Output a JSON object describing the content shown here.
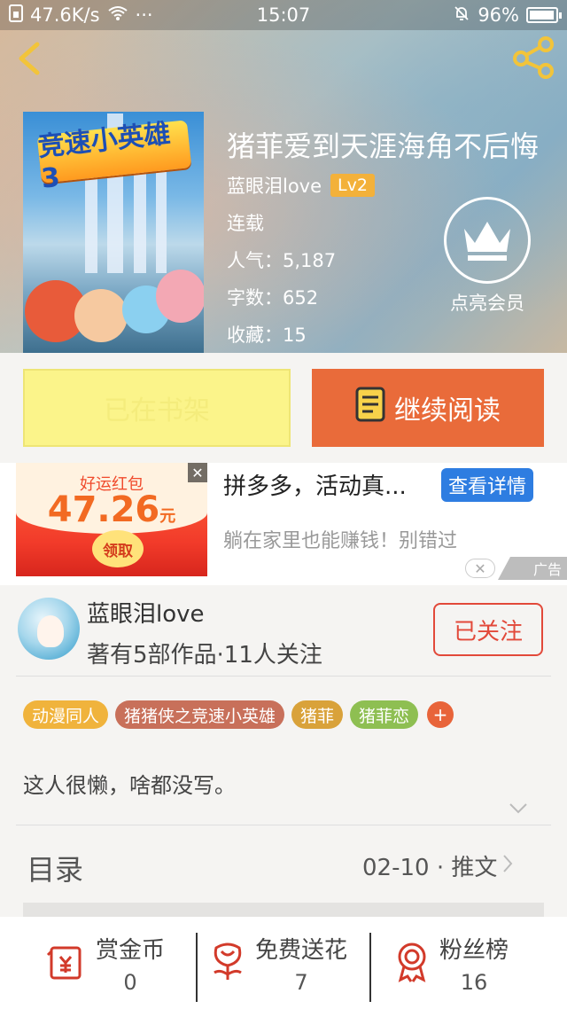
{
  "status_bar": {
    "network_speed": "47.6K/s",
    "dots": "···",
    "time": "15:07",
    "battery": "96%",
    "battery_level": 0.96
  },
  "book": {
    "title": "猪菲爱到天涯海角不后悔",
    "author": "蓝眼泪love",
    "level": "Lv2",
    "status": "连载",
    "popularity": "人气：5,187",
    "word_count": "字数：652",
    "favorites": "收藏：15",
    "cover_logo": "竞速小英雄3"
  },
  "vip": {
    "label": "点亮会员"
  },
  "actions": {
    "shelf_label": "已在书架",
    "read_label": "继续阅读"
  },
  "ad": {
    "image_title": "好运红包",
    "amount": "47.26",
    "unit": "元",
    "claim": "领取",
    "close": "✕",
    "headline": "拼多多，活动真...",
    "detail_button": "查看详情",
    "description": "躺在家里也能赚钱！别错过",
    "tag": "广告",
    "dismiss": "✕"
  },
  "author_section": {
    "name": "蓝眼泪love",
    "stats": "著有5部作品·11人关注",
    "follow_label": "已关注",
    "tags": [
      {
        "label": "动漫同人",
        "color": "#f0b33c"
      },
      {
        "label": "猪猪侠之竞速小英雄",
        "color": "#c8705a"
      },
      {
        "label": "猪菲",
        "color": "#d9a23a"
      },
      {
        "label": "猪菲恋",
        "color": "#8ebf52"
      }
    ],
    "add_tag": "+",
    "bio": "这人很懒，啥都没写。"
  },
  "toc": {
    "label": "目录",
    "info": "02-10 · 推文",
    "arrow": "›"
  },
  "bottom_bar": [
    {
      "label": "赏金币",
      "count": "0",
      "icon": "red-envelope-yen-icon"
    },
    {
      "label": "免费送花",
      "count": "7",
      "icon": "flower-icon"
    },
    {
      "label": "粉丝榜",
      "count": "16",
      "icon": "medal-icon"
    }
  ],
  "colors": {
    "accent": "#e96b3a",
    "follow": "#e2493a",
    "ad_button": "#2e7de1",
    "shelf": "#fbf48a"
  }
}
